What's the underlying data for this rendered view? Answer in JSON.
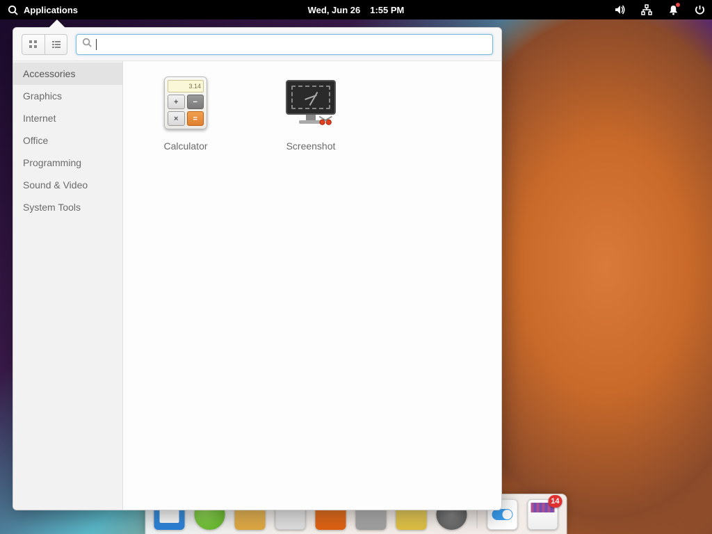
{
  "panel": {
    "applications_label": "Applications",
    "date": "Wed, Jun 26",
    "time": "1:55 PM"
  },
  "menu": {
    "search_placeholder": "",
    "search_value": "",
    "categories": [
      "Accessories",
      "Graphics",
      "Internet",
      "Office",
      "Programming",
      "Sound & Video",
      "System Tools"
    ],
    "selected_category_index": 0,
    "apps": [
      {
        "name": "Calculator",
        "display_value": "3.14"
      },
      {
        "name": "Screenshot"
      }
    ]
  },
  "dock": {
    "badge_count": "14"
  }
}
